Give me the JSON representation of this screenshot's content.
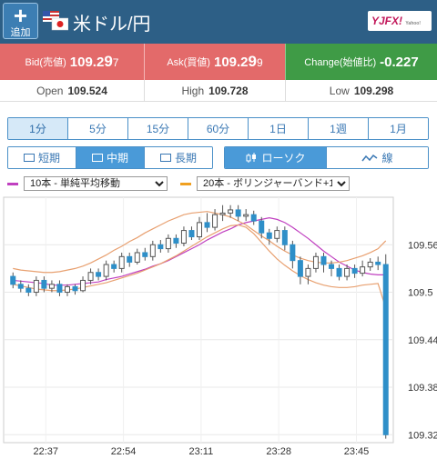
{
  "header": {
    "add_plus": "+",
    "add_label": "追加",
    "pair": "米ドル/円",
    "logo_text": "YJFX!",
    "logo_sub": "Yahoo!"
  },
  "quote": {
    "bid_label": "Bid(売値)",
    "bid_main": "109.2",
    "bid_big": "9",
    "bid_small": "7",
    "ask_label": "Ask(買値)",
    "ask_main": "109.2",
    "ask_big": "9",
    "ask_small": "9",
    "change_label": "Change(始値比)",
    "change_value": "-0.227"
  },
  "ohl": {
    "open_label": "Open",
    "open_value": "109.524",
    "high_label": "High",
    "high_value": "109.728",
    "low_label": "Low",
    "low_value": "109.298"
  },
  "timeframes": [
    "1分",
    "5分",
    "15分",
    "60分",
    "1日",
    "1週",
    "1月"
  ],
  "timeframe_active": 0,
  "terms": [
    "短期",
    "中期",
    "長期"
  ],
  "term_active": 1,
  "chart_types": [
    "ローソク",
    "線"
  ],
  "chart_type_active": 0,
  "indicators": {
    "sma_label": "10本 - 単純平均移動",
    "sma_color": "#c040c0",
    "bb_label": "20本 - ボリンジャーバンド+1",
    "bb_color": "#f0a020"
  },
  "colors": {
    "up": "#ffffff",
    "down": "#2e8fc8",
    "outline": "#555555"
  },
  "chart_data": {
    "type": "candlestick",
    "x_ticks": [
      "22:37",
      "22:54",
      "23:11",
      "23:28",
      "23:45"
    ],
    "y_ticks": [
      109.56,
      109.5,
      109.44,
      109.38,
      109.32
    ],
    "ylim": [
      109.31,
      109.62
    ],
    "series": [
      {
        "name": "10本 - 単純平均移動",
        "values": [
          109.515,
          109.514,
          109.513,
          109.512,
          109.511,
          109.509,
          109.509,
          109.509,
          109.51,
          109.511,
          109.512,
          109.513,
          109.516,
          109.518,
          109.52,
          109.523,
          109.526,
          109.529,
          109.533,
          109.536,
          109.54,
          109.545,
          109.55,
          109.555,
          109.56,
          109.566,
          109.571,
          109.576,
          109.58,
          109.585,
          109.588,
          109.59,
          109.592,
          109.594,
          109.592,
          109.588,
          109.582,
          109.575,
          109.568,
          109.56,
          109.552,
          109.545,
          109.538,
          109.533,
          109.528,
          109.525,
          109.523,
          109.522,
          109.522
        ]
      },
      {
        "name": "20本 - ボリンジャーバンド+1 upper",
        "values": [
          109.53,
          109.528,
          109.527,
          109.526,
          109.525,
          109.525,
          109.526,
          109.528,
          109.53,
          109.533,
          109.537,
          109.542,
          109.547,
          109.553,
          109.558,
          109.564,
          109.569,
          109.575,
          109.58,
          109.585,
          109.59,
          109.594,
          109.598,
          109.6,
          109.601,
          109.602,
          109.6,
          109.598,
          109.595,
          109.59,
          109.585,
          109.578,
          109.571,
          109.565,
          109.558,
          109.552,
          109.547,
          109.543,
          109.54,
          109.538,
          109.537,
          109.537,
          109.538,
          109.54,
          109.543,
          109.546,
          109.55,
          109.555,
          109.565
        ]
      },
      {
        "name": "20本 - ボリンジャーバンド+1 lower",
        "values": [
          109.51,
          109.508,
          109.506,
          109.504,
          109.503,
          109.502,
          109.502,
          109.503,
          109.504,
          109.506,
          109.508,
          109.51,
          109.512,
          109.515,
          109.518,
          109.521,
          109.524,
          109.528,
          109.532,
          109.536,
          109.541,
          109.546,
          109.552,
          109.558,
          109.564,
          109.57,
          109.575,
          109.58,
          109.584,
          109.585,
          109.582,
          109.574,
          109.563,
          109.552,
          109.542,
          109.534,
          109.527,
          109.521,
          109.516,
          109.512,
          109.509,
          109.507,
          109.506,
          109.506,
          109.507,
          109.509,
          109.51,
          109.511,
          109.48
        ]
      }
    ],
    "candles": [
      [
        109.52,
        109.51,
        109.525,
        109.505
      ],
      [
        109.51,
        109.505,
        109.515,
        109.5
      ],
      [
        109.505,
        109.5,
        109.51,
        109.495
      ],
      [
        109.5,
        109.515,
        109.52,
        109.495
      ],
      [
        109.515,
        109.505,
        109.52,
        109.5
      ],
      [
        109.505,
        109.51,
        109.515,
        109.5
      ],
      [
        109.51,
        109.5,
        109.515,
        109.495
      ],
      [
        109.5,
        109.507,
        109.51,
        109.495
      ],
      [
        109.507,
        109.502,
        109.51,
        109.497
      ],
      [
        109.502,
        109.515,
        109.52,
        109.5
      ],
      [
        109.515,
        109.525,
        109.53,
        109.51
      ],
      [
        109.525,
        109.52,
        109.53,
        109.515
      ],
      [
        109.52,
        109.535,
        109.54,
        109.515
      ],
      [
        109.535,
        109.53,
        109.54,
        109.525
      ],
      [
        109.53,
        109.545,
        109.55,
        109.525
      ],
      [
        109.545,
        109.538,
        109.55,
        109.532
      ],
      [
        109.538,
        109.55,
        109.555,
        109.535
      ],
      [
        109.55,
        109.545,
        109.556,
        109.54
      ],
      [
        109.545,
        109.56,
        109.565,
        109.54
      ],
      [
        109.56,
        109.555,
        109.566,
        109.55
      ],
      [
        109.555,
        109.568,
        109.573,
        109.55
      ],
      [
        109.568,
        109.562,
        109.573,
        109.556
      ],
      [
        109.562,
        109.578,
        109.583,
        109.558
      ],
      [
        109.578,
        109.57,
        109.583,
        109.566
      ],
      [
        109.57,
        109.588,
        109.595,
        109.566
      ],
      [
        109.588,
        109.582,
        109.6,
        109.576
      ],
      [
        109.582,
        109.598,
        109.605,
        109.578
      ],
      [
        109.598,
        109.6,
        109.61,
        109.59
      ],
      [
        109.6,
        109.604,
        109.61,
        109.594
      ],
      [
        109.604,
        109.596,
        109.61,
        109.59
      ],
      [
        109.596,
        109.598,
        109.605,
        109.59
      ],
      [
        109.598,
        109.59,
        109.603,
        109.585
      ],
      [
        109.59,
        109.575,
        109.595,
        109.568
      ],
      [
        109.575,
        109.568,
        109.58,
        109.56
      ],
      [
        109.568,
        109.578,
        109.583,
        109.563
      ],
      [
        109.578,
        109.56,
        109.583,
        109.553
      ],
      [
        109.56,
        109.54,
        109.565,
        109.53
      ],
      [
        109.54,
        109.52,
        109.545,
        109.51
      ],
      [
        109.52,
        109.53,
        109.535,
        109.51
      ],
      [
        109.53,
        109.545,
        109.55,
        109.525
      ],
      [
        109.545,
        109.535,
        109.55,
        109.525
      ],
      [
        109.535,
        109.53,
        109.54,
        109.52
      ],
      [
        109.53,
        109.52,
        109.535,
        109.515
      ],
      [
        109.52,
        109.53,
        109.535,
        109.515
      ],
      [
        109.53,
        109.524,
        109.535,
        109.518
      ],
      [
        109.524,
        109.532,
        109.54,
        109.52
      ],
      [
        109.532,
        109.538,
        109.543,
        109.527
      ],
      [
        109.538,
        109.535,
        109.545,
        109.528
      ],
      [
        109.535,
        109.32,
        109.548,
        109.315
      ]
    ]
  }
}
